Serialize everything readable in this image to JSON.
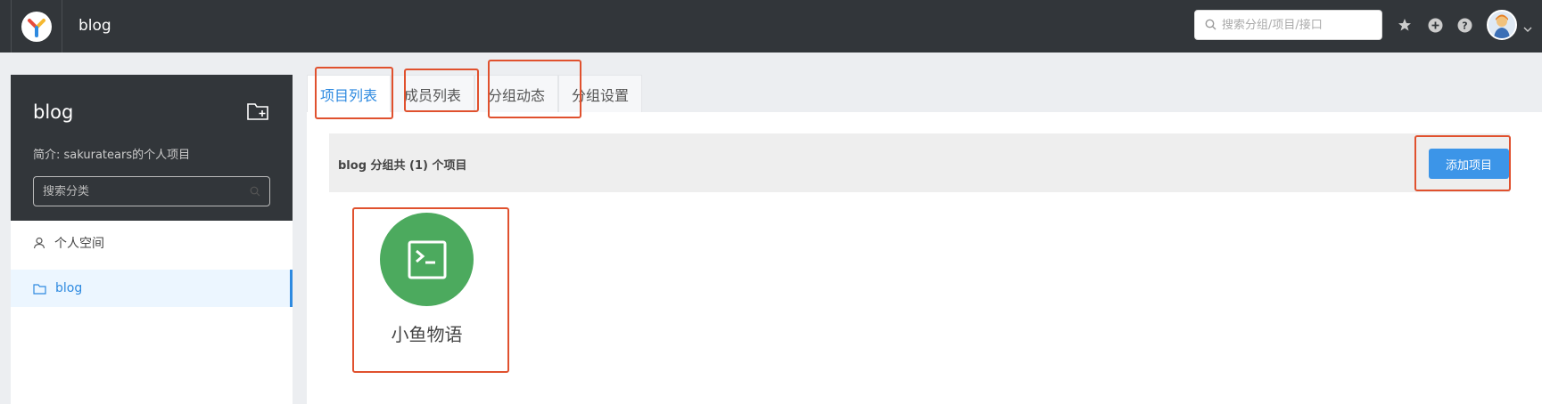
{
  "header": {
    "app_title": "blog",
    "search_placeholder": "搜索分组/项目/接口",
    "icons": [
      "star-icon",
      "plus-circle-icon",
      "question-circle-icon"
    ]
  },
  "sidebar": {
    "group_name": "blog",
    "description": "简介: sakuratears的个人项目",
    "search_placeholder": "搜索分类",
    "items": [
      {
        "label": "个人空间",
        "icon": "user-icon",
        "active": false
      },
      {
        "label": "blog",
        "icon": "folder-icon",
        "active": true
      }
    ]
  },
  "tabs": [
    {
      "label": "项目列表",
      "active": true
    },
    {
      "label": "成员列表",
      "active": false
    },
    {
      "label": "分组动态",
      "active": false
    },
    {
      "label": "分组设置",
      "active": false
    }
  ],
  "project_list": {
    "summary": "blog 分组共 (1) 个项目",
    "add_label": "添加项目",
    "projects": [
      {
        "name": "小鱼物语",
        "icon": "terminal-icon",
        "color": "#4caa5e"
      }
    ]
  },
  "colors": {
    "accent": "#2e8ae0",
    "highlight": "#e0512e",
    "topbar": "#32363a"
  }
}
